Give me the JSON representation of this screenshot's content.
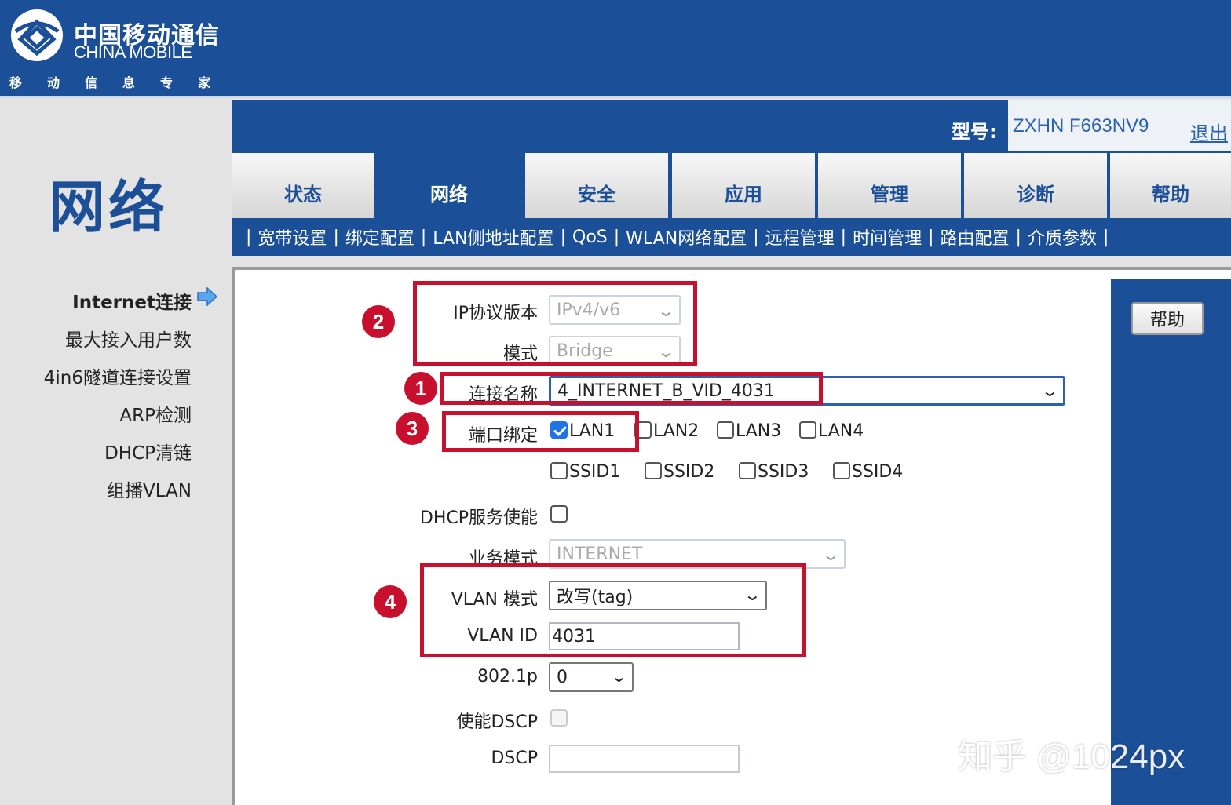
{
  "brand": {
    "name_cn": "中国移动通信",
    "name_en": "CHINA MOBILE",
    "slogan": "移动信息专家"
  },
  "section_title": "网络",
  "header": {
    "model_label": "型号:",
    "model_value": "ZXHN F663NV9",
    "logout": "退出"
  },
  "tabs": [
    {
      "label": "状态"
    },
    {
      "label": "网络"
    },
    {
      "label": "安全"
    },
    {
      "label": "应用"
    },
    {
      "label": "管理"
    },
    {
      "label": "诊断"
    },
    {
      "label": "帮助"
    }
  ],
  "subnav": [
    "宽带设置",
    "绑定配置",
    "LAN侧地址配置",
    "QoS",
    "WLAN网络配置",
    "远程管理",
    "时间管理",
    "路由配置",
    "介质参数"
  ],
  "side_menu": [
    {
      "label": "Internet连接"
    },
    {
      "label": "最大接入用户数"
    },
    {
      "label": "4in6隧道连接设置"
    },
    {
      "label": "ARP检测"
    },
    {
      "label": "DHCP清链"
    },
    {
      "label": "组播VLAN"
    }
  ],
  "help_button": "帮助",
  "form": {
    "ip_version": {
      "label": "IP协议版本",
      "value": "IPv4/v6"
    },
    "mode": {
      "label": "模式",
      "value": "Bridge"
    },
    "conn_name": {
      "label": "连接名称",
      "value": "4_INTERNET_B_VID_4031"
    },
    "port_binding": {
      "label": "端口绑定"
    },
    "ports": [
      {
        "label": "LAN1",
        "checked": true
      },
      {
        "label": "LAN2",
        "checked": false
      },
      {
        "label": "LAN3",
        "checked": false
      },
      {
        "label": "LAN4",
        "checked": false
      },
      {
        "label": "SSID1",
        "checked": false
      },
      {
        "label": "SSID2",
        "checked": false
      },
      {
        "label": "SSID3",
        "checked": false
      },
      {
        "label": "SSID4",
        "checked": false
      }
    ],
    "dhcp": {
      "label": "DHCP服务使能",
      "checked": false
    },
    "service_mode": {
      "label": "业务模式",
      "value": "INTERNET"
    },
    "vlan_mode": {
      "label": "VLAN 模式",
      "value": "改写(tag)"
    },
    "vlan_id": {
      "label": "VLAN ID",
      "value": "4031"
    },
    "dot1p": {
      "label": "802.1p",
      "value": "0"
    },
    "dscp_enable": {
      "label": "使能DSCP",
      "checked": false
    },
    "dscp": {
      "label": "DSCP",
      "value": ""
    }
  },
  "annotations": [
    "1",
    "2",
    "3",
    "4"
  ],
  "watermark": "知乎 @1024px",
  "colors": {
    "primary": "#1b4f98",
    "highlight": "#c8102e",
    "accent": "#2a62b0"
  }
}
